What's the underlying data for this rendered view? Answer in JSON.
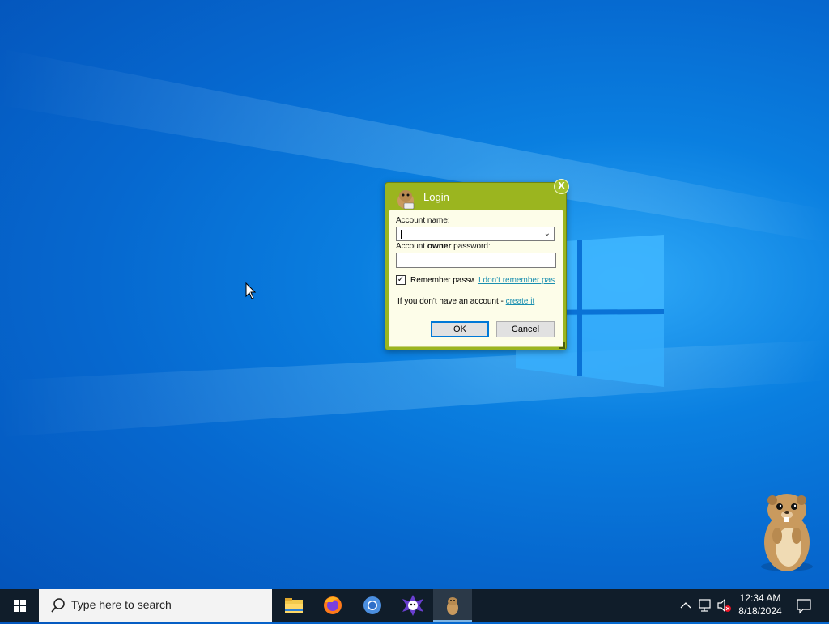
{
  "dialog": {
    "title": "Login",
    "close_label": "X",
    "account_label": "Account name:",
    "account_value": "",
    "password_label_prefix": "Account ",
    "password_label_bold": "owner",
    "password_label_suffix": " password:",
    "password_value": "",
    "remember_label": "Remember passw",
    "remember_checked": true,
    "forgot_link": "I don't remember pas",
    "create_prefix": "If you don't have an account - ",
    "create_link": "create it",
    "ok_label": "OK",
    "cancel_label": "Cancel"
  },
  "taskbar": {
    "search_placeholder": "Type here to search",
    "apps": [
      {
        "name": "file-explorer-icon",
        "active": false
      },
      {
        "name": "firefox-icon",
        "active": false
      },
      {
        "name": "chromium-icon",
        "active": false
      },
      {
        "name": "app-icon",
        "active": false
      },
      {
        "name": "gopher-app-icon",
        "active": true
      }
    ],
    "time": "12:34 AM",
    "date": "8/18/2024"
  },
  "colors": {
    "dialog_frame": "#9bb51f",
    "dialog_body": "#fdfde9",
    "link": "#1a8fb0",
    "taskbar": "#101d2a",
    "desktop": "#0a7fe0"
  }
}
